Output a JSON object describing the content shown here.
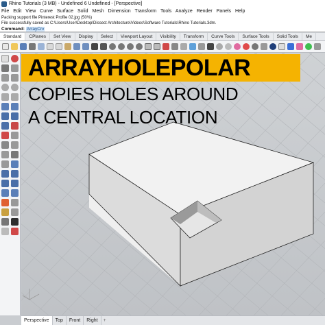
{
  "window": {
    "title": "Rhino Tutorials (3 MB) - Undefined 6 Undefined - [Perspective]"
  },
  "menu": [
    "File",
    "Edit",
    "View",
    "Curve",
    "Surface",
    "Solid",
    "Mesh",
    "Dimension",
    "Transform",
    "Tools",
    "Analyze",
    "Render",
    "Panels",
    "Help"
  ],
  "history": {
    "line1": "Packing support file Pinterest Profile 02.jpg (50%)",
    "line2": "File successfully saved as C:\\Users\\User\\Desktop\\Dissect Architecture\\Videos\\Software Tutorials\\Rhino Tutorials.3dm."
  },
  "command": {
    "label": "Command:",
    "value": "ArrayCrv"
  },
  "toolbar_tabs": [
    "Standard",
    "CPlanes",
    "Set View",
    "Display",
    "Select",
    "Viewport Layout",
    "Visibility",
    "Transform",
    "Curve Tools",
    "Surface Tools",
    "Solid Tools",
    "Me"
  ],
  "viewport_tabs": [
    "Perspective",
    "Top",
    "Front",
    "Right"
  ],
  "overlay": {
    "heading": "ARRAYHOLEPOLAR",
    "line1": "COPIES HOLES AROUND",
    "line2": "A CENTRAL LOCATION"
  },
  "colors": {
    "banner": "#f5b301",
    "viewport_bg": "#c9ccd0"
  }
}
